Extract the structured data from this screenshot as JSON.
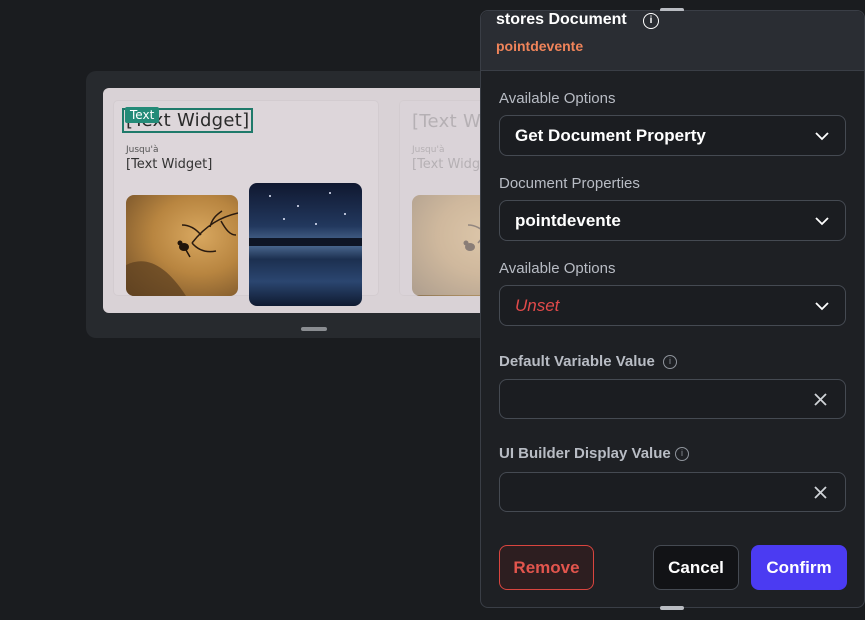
{
  "canvas": {
    "card1": {
      "tag": "Text",
      "title": "[Text Widget]",
      "label": "Jusqu'à",
      "subtext": "[Text Widget]"
    },
    "card2": {
      "title": "[Text Widget]",
      "label": "Jusqu'à",
      "subtext": "[Text Widget]"
    }
  },
  "panel": {
    "title": "stores Document",
    "subtitle": "pointdevente",
    "fields": [
      {
        "label": "Available Options",
        "value": "Get Document Property"
      },
      {
        "label": "Document Properties",
        "value": "pointdevente"
      },
      {
        "label": "Available Options",
        "value": "Unset"
      }
    ],
    "default_variable": {
      "label": "Default Variable Value",
      "value": ""
    },
    "ui_builder_display": {
      "label": "UI Builder Display Value",
      "value": ""
    },
    "buttons": {
      "remove": "Remove",
      "cancel": "Cancel",
      "confirm": "Confirm"
    }
  },
  "colors": {
    "accent": "#4b3bf2",
    "danger": "#e2554d",
    "subtitle": "#f0845a",
    "tag": "#248b78"
  }
}
